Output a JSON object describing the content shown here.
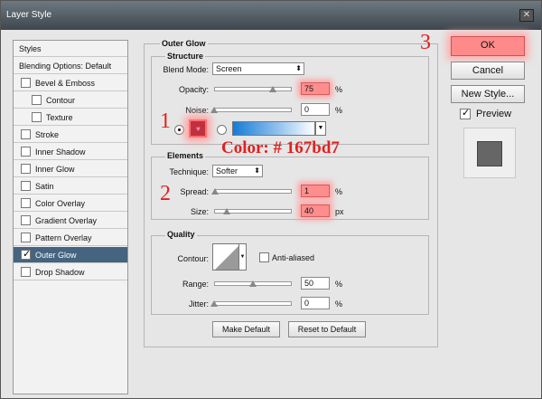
{
  "window": {
    "title": "Layer Style",
    "close_glyph": "✕"
  },
  "sidebar": {
    "items": [
      {
        "label": "Styles"
      },
      {
        "label": "Blending Options: Default"
      },
      {
        "label": "Bevel & Emboss"
      },
      {
        "label": "Contour"
      },
      {
        "label": "Texture"
      },
      {
        "label": "Stroke"
      },
      {
        "label": "Inner Shadow"
      },
      {
        "label": "Inner Glow"
      },
      {
        "label": "Satin"
      },
      {
        "label": "Color Overlay"
      },
      {
        "label": "Gradient Overlay"
      },
      {
        "label": "Pattern Overlay"
      },
      {
        "label": "Outer Glow",
        "checked": true,
        "selected": true
      },
      {
        "label": "Drop Shadow"
      }
    ]
  },
  "panel": {
    "title": "Outer Glow",
    "structure": {
      "title": "Structure",
      "blend_mode_label": "Blend Mode:",
      "blend_mode_value": "Screen",
      "opacity_label": "Opacity:",
      "opacity_value": "75",
      "opacity_level": 0.75,
      "noise_label": "Noise:",
      "noise_value": "0",
      "noise_level": 0,
      "unit": "%"
    },
    "elements": {
      "title": "Elements",
      "technique_label": "Technique:",
      "technique_value": "Softer",
      "spread_label": "Spread:",
      "spread_value": "1",
      "spread_level": 0.01,
      "size_label": "Size:",
      "size_value": "40",
      "size_level": 0.16,
      "pct": "%",
      "px": "px"
    },
    "quality": {
      "title": "Quality",
      "contour_label": "Contour:",
      "antialiased_label": "Anti-aliased",
      "range_label": "Range:",
      "range_value": "50",
      "range_level": 0.5,
      "jitter_label": "Jitter:",
      "jitter_value": "0",
      "jitter_level": 0,
      "unit": "%"
    },
    "make_default_label": "Make Default",
    "reset_default_label": "Reset to Default"
  },
  "right": {
    "ok_label": "OK",
    "cancel_label": "Cancel",
    "new_style_label": "New Style...",
    "preview_label": "Preview"
  },
  "annotations": {
    "n1": "1",
    "n2": "2",
    "n3": "3",
    "color_note": "Color: # 167bd7"
  },
  "colors": {
    "glow_swatch": "#c03040",
    "gradient_start": "#167bd7",
    "highlight": "#ff8d8d",
    "annotation": "#e31f1f"
  }
}
